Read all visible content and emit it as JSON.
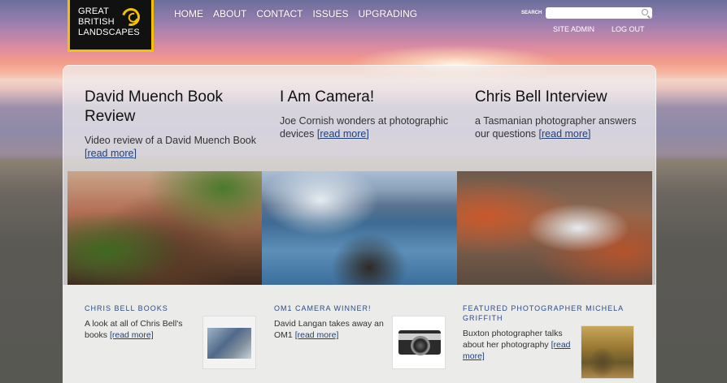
{
  "logo": {
    "lines": [
      "GREAT",
      "BRITISH",
      "LANDSCAPES"
    ],
    "icon": "swirl-logo-icon"
  },
  "nav": {
    "items": [
      "HOME",
      "ABOUT",
      "CONTACT",
      "ISSUES",
      "UPGRADING"
    ]
  },
  "search": {
    "label": "SEARCH",
    "placeholder": ""
  },
  "admin": {
    "site_admin": "SITE ADMIN",
    "log_out": "LOG OUT"
  },
  "features": [
    {
      "title": "David Muench Book Review",
      "text": "Video review of a David Muench Book",
      "read_more": "[read more]"
    },
    {
      "title": "I Am Camera!",
      "text": "Joe Cornish wonders at photographic devices",
      "read_more": "[read more]"
    },
    {
      "title": "Chris Bell Interview",
      "text": "a Tasmanian photographer answers our questions",
      "read_more": "[read more]"
    }
  ],
  "cards": [
    {
      "title": "CHRIS BELL BOOKS",
      "text": "A look at all of Chris Bell's books",
      "read_more": "[read more]"
    },
    {
      "title": "OM1 CAMERA WINNER!",
      "text": "David Langan takes away an OM1",
      "read_more": "[read more]"
    },
    {
      "title": "FEATURED PHOTOGRAPHER MICHELA GRIFFITH",
      "text": "Buxton photographer talks about her photography",
      "read_more": "[read more]"
    }
  ],
  "colors": {
    "logo_border": "#f2c200",
    "link": "#22407a",
    "card_heading": "#2d4a86"
  }
}
